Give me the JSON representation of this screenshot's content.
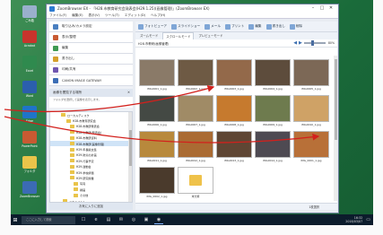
{
  "window": {
    "title": "ZoomBrowser EX - 「H28.市教育研究会発表会(H29.1.25)(画像管理)」(ZoomBrowser EX)",
    "controls": {
      "minimize": "–",
      "maximize": "□",
      "close": "✕"
    }
  },
  "menubar": [
    "ファイル(F)",
    "編集(E)",
    "表示(V)",
    "ツール(T)",
    "エディット(D)",
    "ヘルプ(H)"
  ],
  "left_pane": {
    "tasks": [
      {
        "label": "取り込み/カメラ設定",
        "color": "#4a7fc0"
      },
      {
        "label": "表示/整理",
        "color": "#c85a32"
      },
      {
        "label": "編集",
        "color": "#3f9a52"
      },
      {
        "label": "書き出し",
        "color": "#d6a02c"
      },
      {
        "label": "印刷/共有",
        "color": "#7056b0"
      },
      {
        "label": "CANON iMAGE GATEWAY",
        "color": "#3c6db5"
      }
    ],
    "folder_section": {
      "header": "画像を閲覧する場所",
      "close": "✕",
      "note": "フォルダを選択して画像を表示します。"
    },
    "tree": [
      {
        "label": "ローカルディスク",
        "indent": 12
      },
      {
        "label": "H28.市教育研究会",
        "indent": 18
      },
      {
        "label": "H28.市教研発表会",
        "indent": 22
      },
      {
        "label": "H28.市教研(発表会)",
        "indent": 22
      },
      {
        "label": "H28.市教研資料",
        "indent": 22
      },
      {
        "label": "H28.市教研(画像管理)",
        "indent": 22,
        "selected": true
      },
      {
        "label": "H29.年長版文集",
        "indent": 22
      },
      {
        "label": "H29.防災の計画",
        "indent": 22
      },
      {
        "label": "H29.行事予定",
        "indent": 22
      },
      {
        "label": "H29.運動会",
        "indent": 22
      },
      {
        "label": "H29.学校評価",
        "indent": 22
      },
      {
        "label": "H29.研究授業",
        "indent": 22
      },
      {
        "label": "写真",
        "indent": 26
      },
      {
        "label": "録画",
        "indent": 26
      },
      {
        "label": "その他",
        "indent": 26
      },
      {
        "label": "ドキュメント",
        "indent": 14
      }
    ],
    "footer": "お気に入りに追加"
  },
  "toolbar": {
    "buttons": [
      "フォトビューア",
      "スライドショー",
      "メール",
      "プリント",
      "編集",
      "書き出し",
      "削除"
    ],
    "zoom_label": "80%",
    "count_label": "1枚選択"
  },
  "tabs": [
    {
      "label": "ズームモード"
    },
    {
      "label": "スクロールモード",
      "active": true
    },
    {
      "label": "プレビューモード"
    }
  ],
  "pathbar": {
    "path": "H28.市教研(画像管理)",
    "zoom": "80%",
    "slider_fraction": 0.4
  },
  "thumbnails": [
    {
      "caption": "IMG0001_1.jpg",
      "color": "#8a7a68"
    },
    {
      "caption": "IMG0002_1.jpg",
      "color": "#6e5a44"
    },
    {
      "caption": "IMG0003_1.jpg",
      "color": "#93694a"
    },
    {
      "caption": "IMG0004_1.jpg",
      "color": "#5d4c3c"
    },
    {
      "caption": "IMG0005_1.jpg",
      "color": "#7c6856"
    },
    {
      "caption": "IMG0006_1.jpg",
      "color": "#444944"
    },
    {
      "caption": "IMG0007_1.jpg",
      "color": "#a08b66"
    },
    {
      "caption": "IMG0008_1.jpg",
      "color": "#c67a2e"
    },
    {
      "caption": "IMG0009_1.jpg",
      "color": "#6e7b4e"
    },
    {
      "caption": "IMG0010_1.jpg",
      "color": "#cfa266"
    },
    {
      "caption": "IMG0011_1.jpg",
      "color": "#b8893c"
    },
    {
      "caption": "IMG0012_1.jpg",
      "color": "#aa6b33"
    },
    {
      "caption": "IMG0013_1.jpg",
      "color": "#5f4634"
    },
    {
      "caption": "IMG0014_1.jpg",
      "color": "#4e4a52"
    },
    {
      "caption": "IMG_0001_1.jpg",
      "color": "#b87038"
    },
    {
      "caption": "IMG_0002_1.jpg",
      "color": "#4a3a2c"
    },
    {
      "caption": "未分類",
      "color": "#efc24a",
      "folder": true
    }
  ],
  "statusbar": {
    "text": "1枚選択"
  },
  "desktop_icons": [
    {
      "label": "ごみ箱",
      "color": "#9ab0cc"
    },
    {
      "label": "Acrobat",
      "color": "#c8342c"
    },
    {
      "label": "Excel",
      "color": "#2f8a4e"
    },
    {
      "label": "Word",
      "color": "#2b5fad"
    },
    {
      "label": "Edge",
      "color": "#1f74c8"
    },
    {
      "label": "PowerPoint",
      "color": "#c85a32"
    },
    {
      "label": "フォルダ",
      "color": "#e9c44a"
    },
    {
      "label": "ZoomBrowser",
      "color": "#3b6bb4"
    }
  ],
  "taskbar": {
    "start": "⊞",
    "search_placeholder": "ここに入力して検索",
    "apps": [
      "☐",
      "e",
      "▤",
      "✉",
      "◎",
      "▣",
      "◉"
    ],
    "time": "16:32",
    "date": "2018/03/07",
    "notify_icon": "▭"
  },
  "annotations": {
    "color": "#d3201c"
  }
}
